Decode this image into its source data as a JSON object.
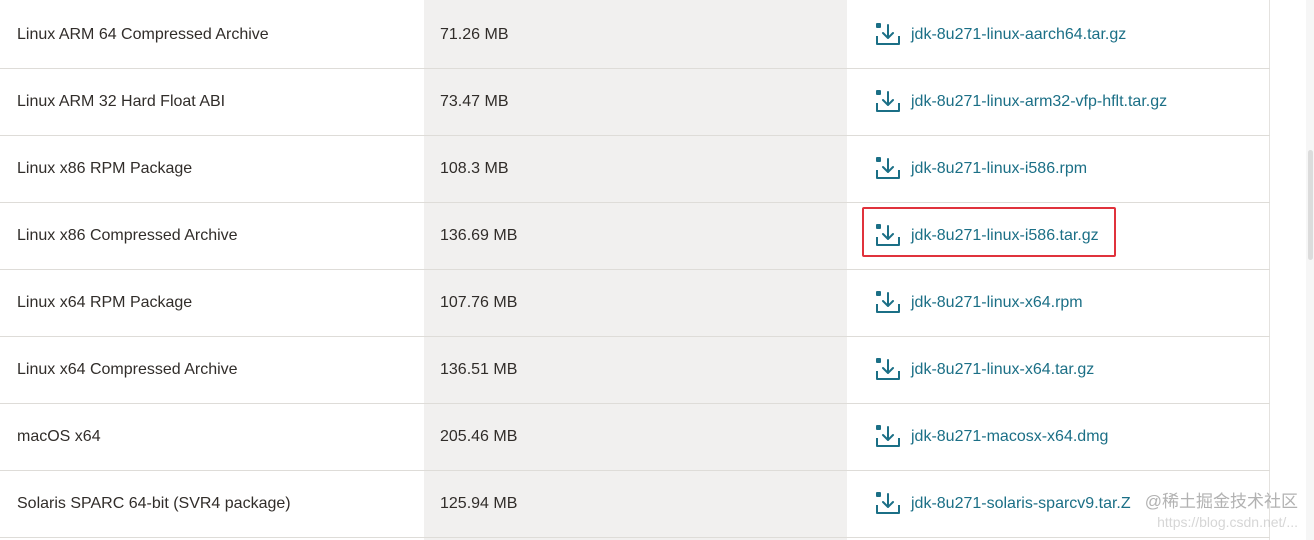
{
  "downloads_table": {
    "rows": [
      {
        "product": "Linux ARM 64 Compressed Archive",
        "size": "71.26 MB",
        "file": "jdk-8u271-linux-aarch64.tar.gz"
      },
      {
        "product": "Linux ARM 32 Hard Float ABI",
        "size": "73.47 MB",
        "file": "jdk-8u271-linux-arm32-vfp-hflt.tar.gz"
      },
      {
        "product": "Linux x86 RPM Package",
        "size": "108.3 MB",
        "file": "jdk-8u271-linux-i586.rpm"
      },
      {
        "product": "Linux x86 Compressed Archive",
        "size": "136.69 MB",
        "file": "jdk-8u271-linux-i586.tar.gz"
      },
      {
        "product": "Linux x64 RPM Package",
        "size": "107.76 MB",
        "file": "jdk-8u271-linux-x64.rpm"
      },
      {
        "product": "Linux x64 Compressed Archive",
        "size": "136.51 MB",
        "file": "jdk-8u271-linux-x64.tar.gz"
      },
      {
        "product": "macOS x64",
        "size": "205.46 MB",
        "file": "jdk-8u271-macosx-x64.dmg"
      },
      {
        "product": "Solaris SPARC 64-bit (SVR4 package)",
        "size": "125.94 MB",
        "file": "jdk-8u271-solaris-sparcv9.tar.Z"
      }
    ]
  },
  "icons": {
    "download": "download-icon"
  },
  "colors": {
    "link": "#1b6f86",
    "text": "#312d2a",
    "highlight": "#e0323c",
    "size_column_bg": "#f1f0ef"
  },
  "watermark": {
    "main": "@稀土掘金技术社区",
    "sub": "https://blog.csdn.net/..."
  }
}
